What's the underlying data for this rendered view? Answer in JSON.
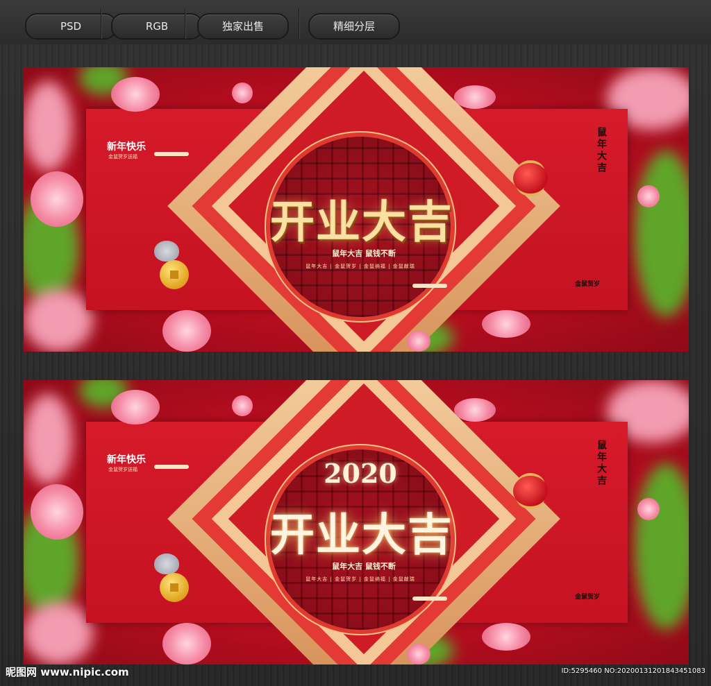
{
  "toolbar": {
    "buttons": [
      {
        "label": "PSD"
      },
      {
        "label": "RGB"
      },
      {
        "label": "独家出售"
      },
      {
        "label": "精细分层"
      }
    ]
  },
  "banner": {
    "main_title": "开业大吉",
    "subtitle": "鼠年大吉  鼠钱不断",
    "subrow": "鼠年大吉 | 金鼠贺岁 | 金鼠纳福 | 金鼠献瑞",
    "left_title": "新年快乐",
    "left_small": "金鼠贺岁送福",
    "vertical_text": "鼠年大吉",
    "stamp": "金鼠贺岁",
    "colors": {
      "red": "#c51222",
      "gold": "#fbe0a4",
      "green": "#5fa52a",
      "pink": "#f39bb0"
    }
  },
  "banner2": {
    "year_art": "2020"
  },
  "footer": {
    "logo": "昵图网 www.nipic.com",
    "id": "ID:5295460 NO:20200131201843451083"
  }
}
